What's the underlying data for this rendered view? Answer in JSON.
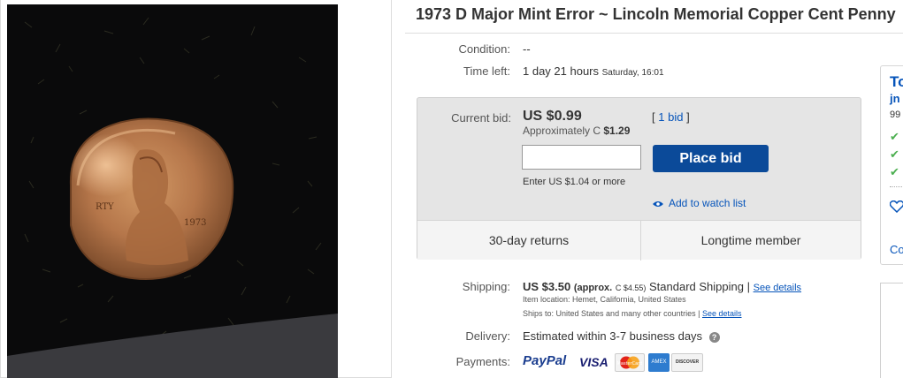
{
  "listing": {
    "title": "1973 D Major Mint Error ~ Lincoln Memorial Copper Cent Penny"
  },
  "photo": {
    "coin_text_1": "RTY",
    "coin_text_2": "1973"
  },
  "details": {
    "condition_label": "Condition:",
    "condition_value": "--",
    "time_left_label": "Time left:",
    "time_left_value": "1 day 21 hours",
    "time_left_end": "Saturday, 16:01"
  },
  "bid": {
    "current_bid_label": "Current bid:",
    "price": "US $0.99",
    "approx_prefix": "Approximately C",
    "approx_value": "$1.29",
    "bid_count_open": "[",
    "bid_count": "1 bid",
    "bid_count_close": "]",
    "input_value": "",
    "enter_hint": "Enter US $1.04 or more",
    "place_bid_label": "Place bid",
    "watch_label": "Add to watch list",
    "feature_returns": "30-day returns",
    "feature_member": "Longtime member"
  },
  "shipping": {
    "label": "Shipping:",
    "cost": "US $3.50",
    "approx": "(approx.",
    "approx_value": "C $4.55)",
    "method": "Standard Shipping |",
    "see_details": "See details",
    "item_location": "Item location:  Hemet, California, United States",
    "ships_to_prefix": "Ships to:  United States and many other countries |",
    "ships_to_link": "See details"
  },
  "delivery": {
    "label": "Delivery:",
    "value": "Estimated within 3-7 business days",
    "help_icon": "?"
  },
  "payments": {
    "label": "Payments:",
    "paypal": "PayPal",
    "visa": "VISA",
    "mastercard": "MasterCard",
    "amex": "AMEX",
    "discover": "DISCOVER"
  },
  "seller": {
    "header": "To",
    "name": "jn",
    "score": "99",
    "contact": "Co"
  },
  "colors": {
    "accent": "#0654ba",
    "button": "#0b4a99",
    "check": "#4caf50"
  }
}
